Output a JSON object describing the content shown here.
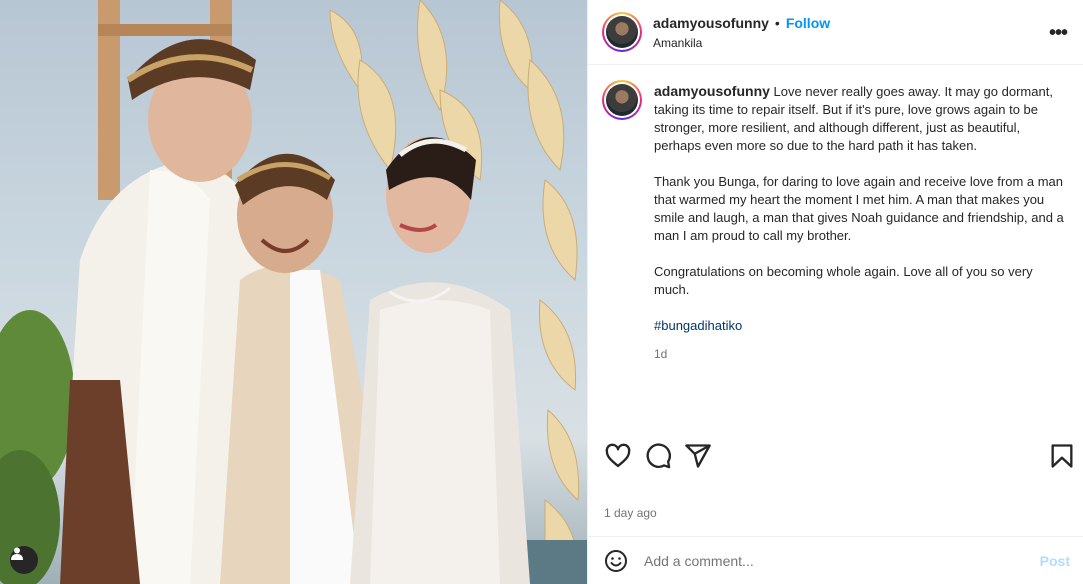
{
  "post": {
    "username": "adamyousofunny",
    "separator": "•",
    "follow_label": "Follow",
    "location": "Amankila",
    "more_label": "•••",
    "caption_paragraphs": [
      "Love never really goes away. It may go dormant, taking its time to repair itself. But if it's pure, love grows again to be stronger, more resilient, and although different, just as beautiful, perhaps even more so due to the hard path it has taken.",
      "Thank you Bunga, for daring to love again and receive love from a man that warmed my heart the moment I met him. A man that makes you smile and laugh, a man that gives Noah guidance and friendship, and a man I am proud to call my brother.",
      "Congratulations on becoming whole again. Love all of you so very much."
    ],
    "hashtag": "#bungadihatiko",
    "caption_age": "1d",
    "date": "1 day ago",
    "comment_placeholder": "Add a comment...",
    "post_label": "Post"
  },
  "icons": {
    "like": "heart-icon",
    "comment": "comment-icon",
    "share": "share-icon",
    "save": "bookmark-icon",
    "emoji": "emoji-icon",
    "tag": "user-tag-icon"
  },
  "colors": {
    "link": "#0095f6",
    "hashtag": "#00376b",
    "muted": "#737373",
    "post_disabled": "#b3dbff"
  }
}
